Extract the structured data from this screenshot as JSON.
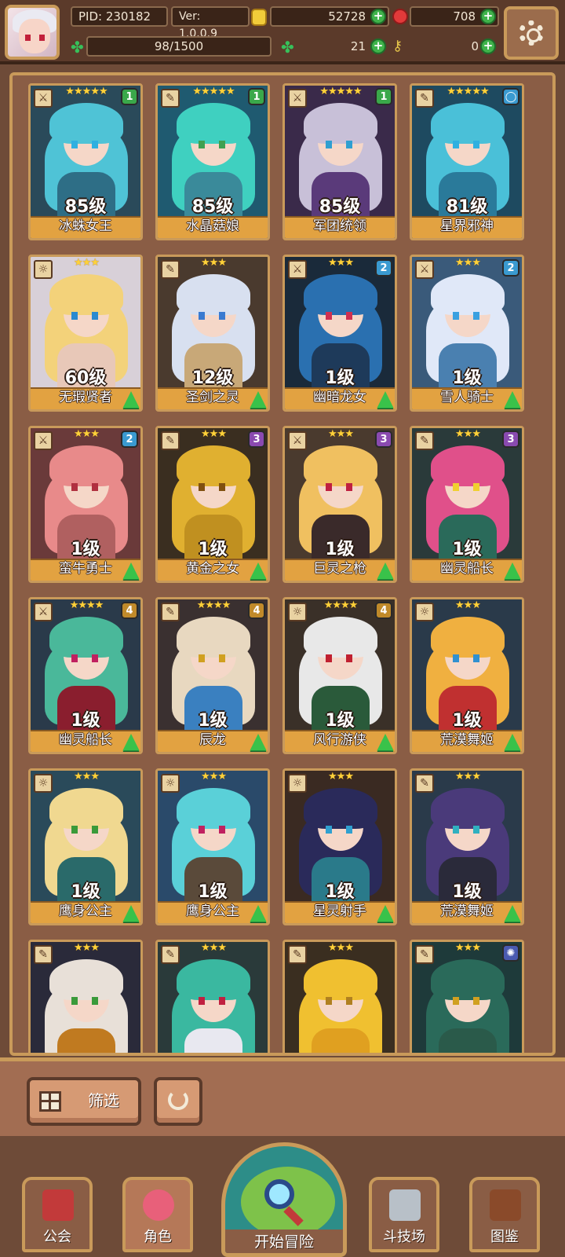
{
  "hud": {
    "pid": "PID: 230182",
    "version": "Ver: 1.0.0.9",
    "gold": "52728",
    "gems": "708",
    "exp": "98/1500",
    "clover": "21",
    "keys": "0"
  },
  "cards": [
    {
      "stars": "★★★★★",
      "badge": "1",
      "badge_color": "#3aa84a",
      "level": "85级",
      "name": "冰蛛女王",
      "up": false,
      "weapon": "⚔",
      "hair": "#4fc3d6",
      "body": "#2e6e86",
      "bg": "#2a4a5a",
      "eye": "#2fb0e0"
    },
    {
      "stars": "★★★★★",
      "badge": "1",
      "badge_color": "#3aa84a",
      "level": "85级",
      "name": "水晶菇娘",
      "up": false,
      "weapon": "✎",
      "hair": "#3fd0c0",
      "body": "#3a8a9a",
      "bg": "#1f5a70",
      "eye": "#3fa050"
    },
    {
      "stars": "★★★★★",
      "badge": "1",
      "badge_color": "#3aa84a",
      "level": "85级",
      "name": "军团统领",
      "up": false,
      "weapon": "⚔",
      "hair": "#c8c0d8",
      "body": "#5a3a7a",
      "bg": "#3a2a4a",
      "eye": "#2f9fd0"
    },
    {
      "stars": "★★★★★",
      "badge": "◯",
      "badge_color": "#3a9ad0",
      "level": "81级",
      "name": "星界邪神",
      "up": false,
      "weapon": "✎",
      "hair": "#4ac0d8",
      "body": "#2a7a9a",
      "bg": "#1e4a60",
      "eye": "#30b0e0"
    },
    {
      "stars": "★★★",
      "badge": "",
      "badge_color": "",
      "level": "60级",
      "name": "无瑕贤者",
      "up": true,
      "weapon": "☼",
      "hair": "#f3d27a",
      "body": "#e8c8b8",
      "bg": "#d8d0d8",
      "eye": "#2a8ad0"
    },
    {
      "stars": "★★★",
      "badge": "",
      "badge_color": "",
      "level": "12级",
      "name": "圣剑之灵",
      "up": true,
      "weapon": "✎",
      "hair": "#d8e0f0",
      "body": "#c8a878",
      "bg": "#4a3a2e",
      "eye": "#3a7ad0"
    },
    {
      "stars": "★★★",
      "badge": "2",
      "badge_color": "#3a9ad0",
      "level": "1级",
      "name": "幽暗龙女",
      "up": true,
      "weapon": "⚔",
      "hair": "#2a70b0",
      "body": "#1e3a5a",
      "bg": "#1a2a3a",
      "eye": "#d03050"
    },
    {
      "stars": "★★★",
      "badge": "2",
      "badge_color": "#3a9ad0",
      "level": "1级",
      "name": "雪人骑士",
      "up": true,
      "weapon": "⚔",
      "hair": "#e0e8f8",
      "body": "#4a80b0",
      "bg": "#3a5a7a",
      "eye": "#3aa0e0"
    },
    {
      "stars": "★★★",
      "badge": "2",
      "badge_color": "#3a9ad0",
      "level": "1级",
      "name": "蛮牛勇士",
      "up": true,
      "weapon": "⚔",
      "hair": "#e88a8a",
      "body": "#b06060",
      "bg": "#6a3a3a",
      "eye": "#b03040"
    },
    {
      "stars": "★★★",
      "badge": "3",
      "badge_color": "#8a4ab0",
      "level": "1级",
      "name": "黄金之女",
      "up": true,
      "weapon": "✎",
      "hair": "#e0b030",
      "body": "#c09020",
      "bg": "#3a2e20",
      "eye": "#805010"
    },
    {
      "stars": "★★★",
      "badge": "3",
      "badge_color": "#8a4ab0",
      "level": "1级",
      "name": "巨灵之枪",
      "up": true,
      "weapon": "⚔",
      "hair": "#f0c060",
      "body": "#3a2a2a",
      "bg": "#4a3a2e",
      "eye": "#c02040"
    },
    {
      "stars": "★★★",
      "badge": "3",
      "badge_color": "#8a4ab0",
      "level": "1级",
      "name": "幽灵船长",
      "up": true,
      "weapon": "✎",
      "hair": "#e0508a",
      "body": "#2a6a5a",
      "bg": "#2a3a3a",
      "eye": "#f0d030"
    },
    {
      "stars": "★★★★",
      "badge": "4",
      "badge_color": "#c08a2a",
      "level": "1级",
      "name": "幽灵船长",
      "up": true,
      "weapon": "⚔",
      "hair": "#4ab89a",
      "body": "#8a1e2e",
      "bg": "#2a3a4a",
      "eye": "#c02060"
    },
    {
      "stars": "★★★★",
      "badge": "4",
      "badge_color": "#c08a2a",
      "level": "1级",
      "name": "辰龙",
      "up": true,
      "weapon": "✎",
      "hair": "#e8d8c0",
      "body": "#3a80c0",
      "bg": "#3a3030",
      "eye": "#d0a020"
    },
    {
      "stars": "★★★★",
      "badge": "4",
      "badge_color": "#c08a2a",
      "level": "1级",
      "name": "风行游侠",
      "up": true,
      "weapon": "☼",
      "hair": "#e8e8e8",
      "body": "#2a5a3a",
      "bg": "#3a3028",
      "eye": "#c02030"
    },
    {
      "stars": "★★★",
      "badge": "",
      "badge_color": "",
      "level": "1级",
      "name": "荒漠舞姬",
      "up": true,
      "weapon": "☼",
      "hair": "#f0b040",
      "body": "#c03030",
      "bg": "#2a3a4a",
      "eye": "#3090d0"
    },
    {
      "stars": "★★★",
      "badge": "",
      "badge_color": "",
      "level": "1级",
      "name": "鹰身公主",
      "up": true,
      "weapon": "☼",
      "hair": "#f0d890",
      "body": "#2a6a6a",
      "bg": "#2a4a5a",
      "eye": "#3a9a3a"
    },
    {
      "stars": "★★★",
      "badge": "",
      "badge_color": "",
      "level": "1级",
      "name": "鹰身公主",
      "up": true,
      "weapon": "☼",
      "hair": "#5ad0d8",
      "body": "#5a4a3a",
      "bg": "#2a4a6a",
      "eye": "#c02060"
    },
    {
      "stars": "★★★",
      "badge": "",
      "badge_color": "",
      "level": "1级",
      "name": "星灵射手",
      "up": true,
      "weapon": "☼",
      "hair": "#2a2a5a",
      "body": "#2a7a8a",
      "bg": "#3a2a22",
      "eye": "#30a0d0"
    },
    {
      "stars": "★★★",
      "badge": "",
      "badge_color": "",
      "level": "1级",
      "name": "荒漠舞姬",
      "up": true,
      "weapon": "✎",
      "hair": "#4a3a7a",
      "body": "#2a2a3a",
      "bg": "#2a3a4a",
      "eye": "#30b0c0"
    },
    {
      "stars": "★★★",
      "badge": "",
      "badge_color": "",
      "level": "",
      "name": "",
      "up": false,
      "weapon": "✎",
      "hair": "#e8e0d8",
      "body": "#c07a20",
      "bg": "#2a2a3a",
      "eye": "#3a9a3a"
    },
    {
      "stars": "★★★",
      "badge": "",
      "badge_color": "",
      "level": "",
      "name": "",
      "up": false,
      "weapon": "✎",
      "hair": "#3ab8a0",
      "body": "#e8e8f0",
      "bg": "#2a3a3a",
      "eye": "#c02040"
    },
    {
      "stars": "★★★",
      "badge": "",
      "badge_color": "",
      "level": "",
      "name": "",
      "up": false,
      "weapon": "✎",
      "hair": "#f0c030",
      "body": "#e0a020",
      "bg": "#3a2e20",
      "eye": "#b08020"
    },
    {
      "stars": "★★★",
      "badge": "✺",
      "badge_color": "#4a5ab0",
      "level": "",
      "name": "",
      "up": false,
      "weapon": "✎",
      "hair": "#2a6a5a",
      "body": "#2a5a4a",
      "bg": "#1e3a3a",
      "eye": "#d0a020"
    }
  ],
  "filter": {
    "label": "筛选"
  },
  "nav": {
    "guild": "公会",
    "character": "角色",
    "adventure": "开始冒险",
    "arena": "斗技场",
    "codex": "图鉴"
  }
}
